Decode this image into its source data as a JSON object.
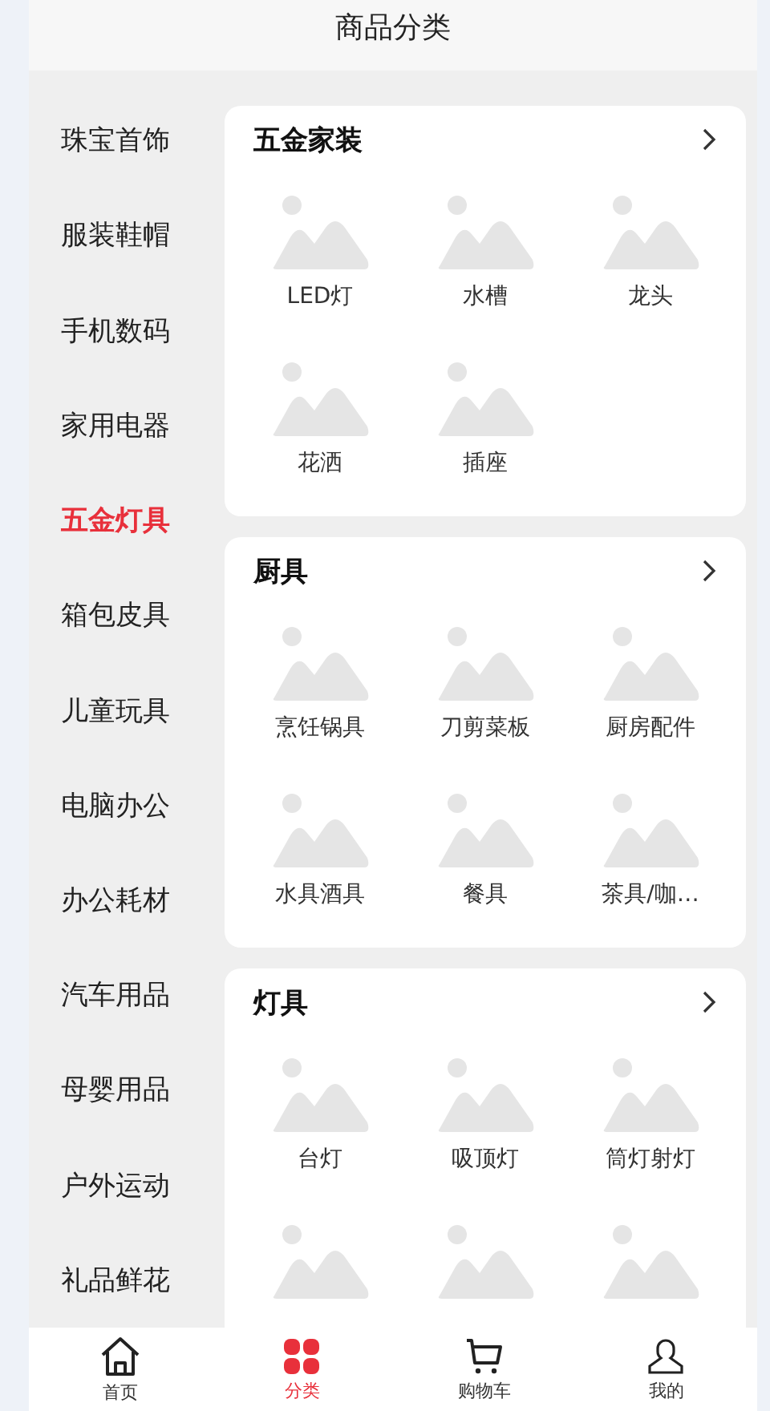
{
  "header": {
    "title": "商品分类"
  },
  "sidebar": {
    "items": [
      {
        "label": "珠宝首饰",
        "selected": false
      },
      {
        "label": "服装鞋帽",
        "selected": false
      },
      {
        "label": "手机数码",
        "selected": false
      },
      {
        "label": "家用电器",
        "selected": false
      },
      {
        "label": "五金灯具",
        "selected": true
      },
      {
        "label": "箱包皮具",
        "selected": false
      },
      {
        "label": "儿童玩具",
        "selected": false
      },
      {
        "label": "电脑办公",
        "selected": false
      },
      {
        "label": "办公耗材",
        "selected": false
      },
      {
        "label": "汽车用品",
        "selected": false
      },
      {
        "label": "母婴用品",
        "selected": false
      },
      {
        "label": "户外运动",
        "selected": false
      },
      {
        "label": "礼品鲜花",
        "selected": false
      }
    ]
  },
  "sections": [
    {
      "title": "五金家装",
      "items": [
        "LED灯",
        "水槽",
        "龙头",
        "花洒",
        "插座"
      ]
    },
    {
      "title": "厨具",
      "items": [
        "烹饪锅具",
        "刀剪菜板",
        "厨房配件",
        "水具酒具",
        "餐具",
        "茶具/咖…"
      ]
    },
    {
      "title": "灯具",
      "items": [
        "台灯",
        "吸顶灯",
        "筒灯射灯"
      ],
      "unlabeled_items": [
        {
          "kind": "picture"
        },
        {
          "kind": "picture"
        },
        {
          "kind": "picture"
        }
      ]
    }
  ],
  "tab_bar": [
    {
      "label": "首页",
      "kind": "home",
      "selected": false
    },
    {
      "label": "分类",
      "kind": "category",
      "selected": true
    },
    {
      "label": "购物车",
      "kind": "cart",
      "selected": false
    },
    {
      "label": "我的",
      "kind": "user",
      "selected": false
    }
  ]
}
